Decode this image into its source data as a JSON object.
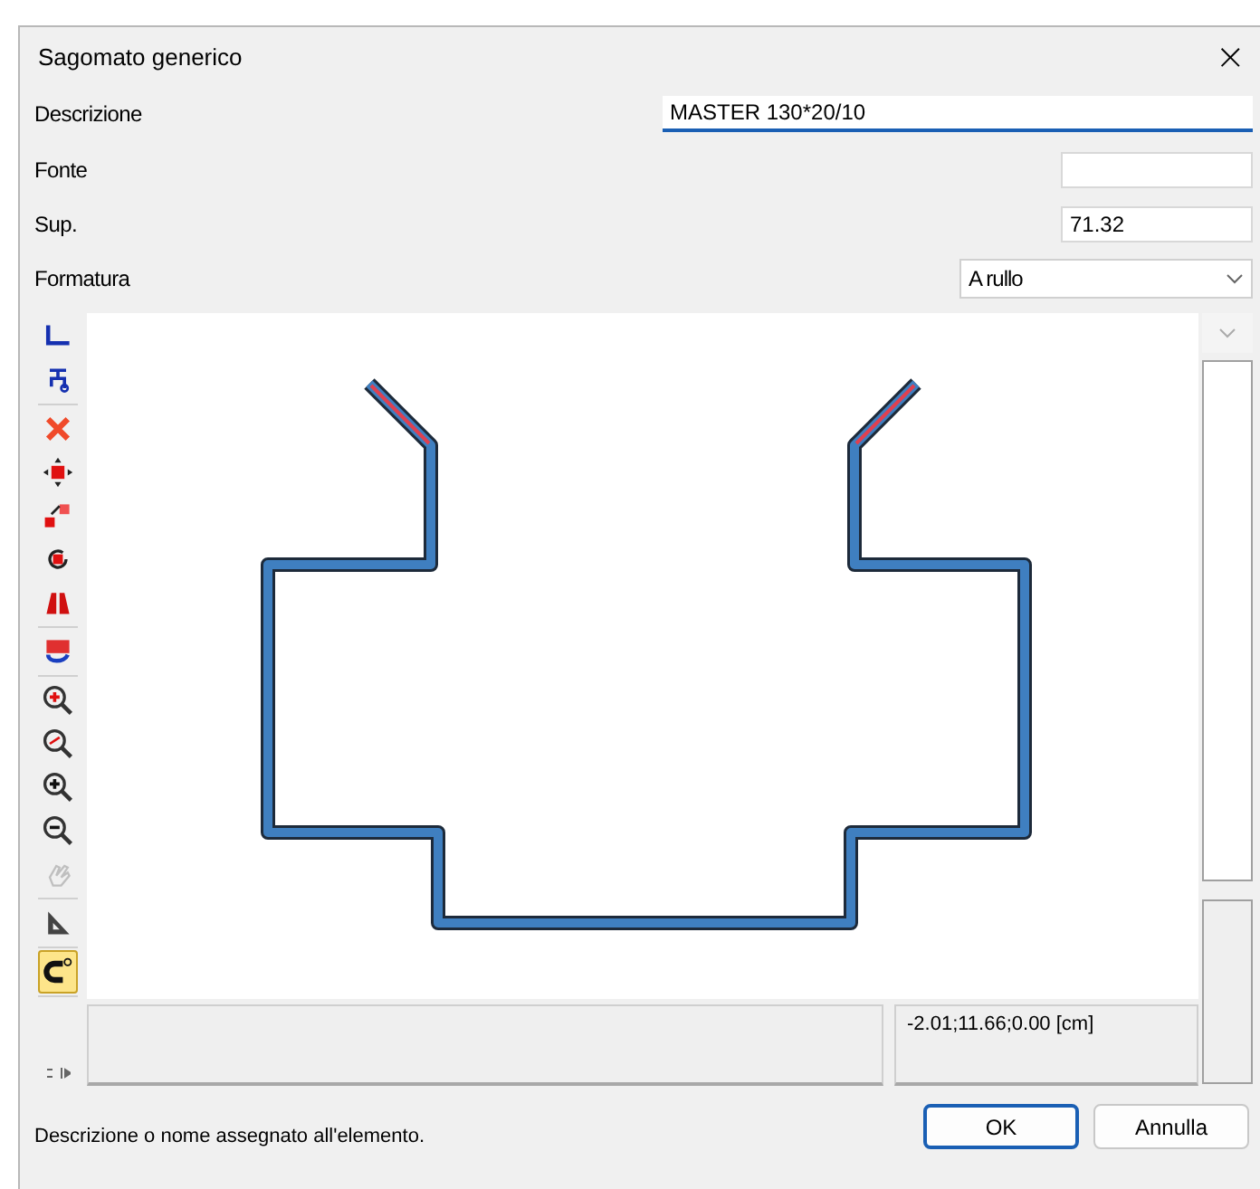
{
  "window": {
    "title": "Sagomato generico",
    "close": "×"
  },
  "fields": [
    {
      "label": "Descrizione",
      "kind": "long-text",
      "value": "MASTER 130*20/10",
      "focused": true
    },
    {
      "label": "Fonte",
      "kind": "text",
      "focused": false
    },
    {
      "label": "Sup.",
      "kind": "text",
      "value": "71.32",
      "focused": false
    },
    {
      "label": "Formatura",
      "kind": "dropdown",
      "value": "A rullo",
      "focused": false
    }
  ],
  "toolbar": [
    {
      "tools": [
        {
          "kind": "shape",
          "selected": false,
          "disabled": false
        },
        {
          "kind": "tree",
          "selected": false,
          "disabled": false
        }
      ]
    },
    {
      "tools": [
        {
          "kind": "delete",
          "selected": false,
          "disabled": false
        },
        {
          "kind": "move",
          "selected": false,
          "disabled": false
        },
        {
          "kind": "copy",
          "selected": false,
          "disabled": false
        },
        {
          "kind": "rotate",
          "selected": false,
          "disabled": false
        },
        {
          "kind": "mirror",
          "selected": false,
          "disabled": false
        }
      ]
    },
    {
      "tools": [
        {
          "kind": "swap",
          "selected": false,
          "disabled": false
        }
      ]
    },
    {
      "tools": [
        {
          "kind": "zoom-window",
          "selected": false,
          "disabled": false
        },
        {
          "kind": "zoom-extents",
          "selected": false,
          "disabled": false
        },
        {
          "kind": "zoom-in",
          "selected": false,
          "disabled": false
        },
        {
          "kind": "zoom-out",
          "selected": false,
          "disabled": false
        },
        {
          "kind": "pan",
          "selected": false,
          "disabled": true
        }
      ]
    },
    {
      "tools": [
        {
          "kind": "ruler",
          "selected": false,
          "disabled": false
        }
      ]
    },
    {
      "tools": [
        {
          "kind": "magnet",
          "selected": true,
          "disabled": false
        }
      ]
    }
  ],
  "coordinates": "-2.01;11.66;0.00 [cm]",
  "status_bar": "Descrizione o nome assegnato all'elemento.",
  "buttons": [
    {
      "label": "OK",
      "default": true
    },
    {
      "label": "Annulla",
      "default": false
    }
  ]
}
